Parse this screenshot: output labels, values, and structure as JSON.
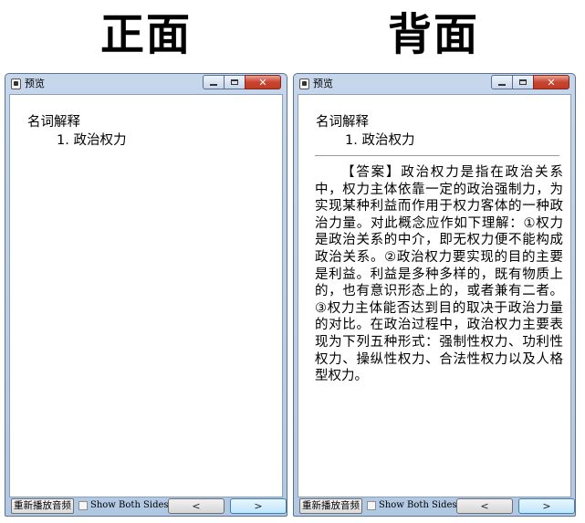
{
  "headings": {
    "front": "正面",
    "back": "背面"
  },
  "window": {
    "title": "预览",
    "minimize_symbol": "",
    "close_symbol": "✕"
  },
  "card": {
    "section": "名词解释",
    "term": "1. 政治权力",
    "answer": "【答案】政治权力是指在政治关系中，权力主体依靠一定的政治强制力，为实现某种利益而作用于权力客体的一种政治力量。对此概念应作如下理解：①权力是政治关系的中介，即无权力便不能构成政治关系。②政治权力要实现的目的主要是利益。利益是多种多样的，既有物质上的，也有意识形态上的，或者兼有二者。③权力主体能否达到目的取决于政治力量的对比。在政治过程中，政治权力主要表现为下列五种形式：强制性权力、功利性权力、操纵性权力、合法性权力以及人格型权力。"
  },
  "toolbar": {
    "replay_label": "重新播放音频",
    "show_both_label": "Show Both Sides",
    "prev_symbol": "<",
    "next_symbol": ">"
  },
  "colors": {
    "close_button": "#c8452f",
    "frame": "#b1c8e3",
    "next_button": "#bee6fd"
  }
}
